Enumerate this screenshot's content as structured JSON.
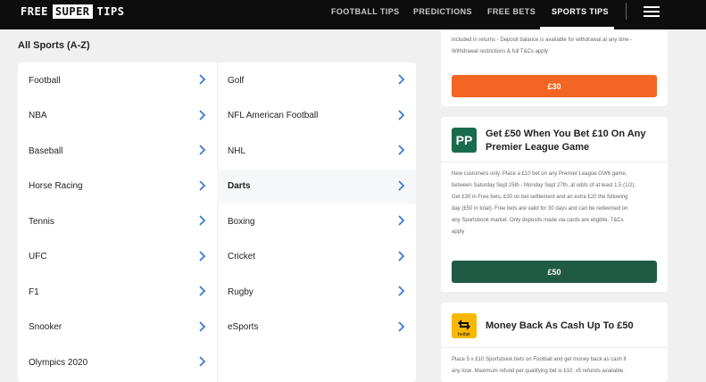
{
  "header": {
    "logo": [
      "FREE",
      "SUPER",
      "TIPS"
    ],
    "nav": [
      {
        "label": "FOOTBALL TIPS",
        "active": false
      },
      {
        "label": "PREDICTIONS",
        "active": false
      },
      {
        "label": "FREE BETS",
        "active": false
      },
      {
        "label": "SPORTS TIPS",
        "active": true
      }
    ],
    "menu_icon": "hamburger-menu-icon"
  },
  "sports": {
    "title": "All Sports (A-Z)",
    "left_column": [
      "Football",
      "NBA",
      "Baseball",
      "Horse Racing",
      "Tennis",
      "UFC",
      "F1",
      "Snooker",
      "Olympics 2020"
    ],
    "right_column": [
      "Golf",
      "NFL American Football",
      "NHL",
      "Darts",
      "Boxing",
      "Cricket",
      "Rugby",
      "eSports"
    ],
    "highlighted": "Darts",
    "chevron_icon": "chevron-right-icon",
    "accent": "#3a7bd5"
  },
  "offers": [
    {
      "terms": [
        "included in returns - Deposit balance is available for withdrawal at any time -",
        "Withdrawal restrictions & full T&Cs apply"
      ],
      "cta": "£30",
      "cta_color": "#f26522"
    },
    {
      "brand_text": "PP",
      "brand_icon": "paddy-power-logo-icon",
      "title": "Get £50 When You Bet £10 On Any Premier League Game",
      "terms": [
        "New customers only. Place a £10 bet on any Premier League GW6 game,",
        "between Saturday Sept 25th - Monday Sept 27th, at odds of at least 1.5 (1/2).",
        "Get £30 in Free bets, £30 on bet settlement and an extra £20 the following",
        "day (£50 in total). Free bets are valid for 30 days and can be redeemed on",
        "any Sportsbook market. Only deposits made via cards are eligible. T&Cs",
        "apply"
      ],
      "cta": "£50",
      "cta_color": "#1f5b44"
    },
    {
      "brand_text": "betfair",
      "brand_icon": "betfair-logo-icon",
      "title": "Money Back As Cash Up To £50",
      "terms": [
        "Place 5 x £10 Sportsbook bets on Football and get money back as cash if",
        "any lose. Maximum refund per qualifying bet is £10. x5 refunds available."
      ]
    }
  ]
}
